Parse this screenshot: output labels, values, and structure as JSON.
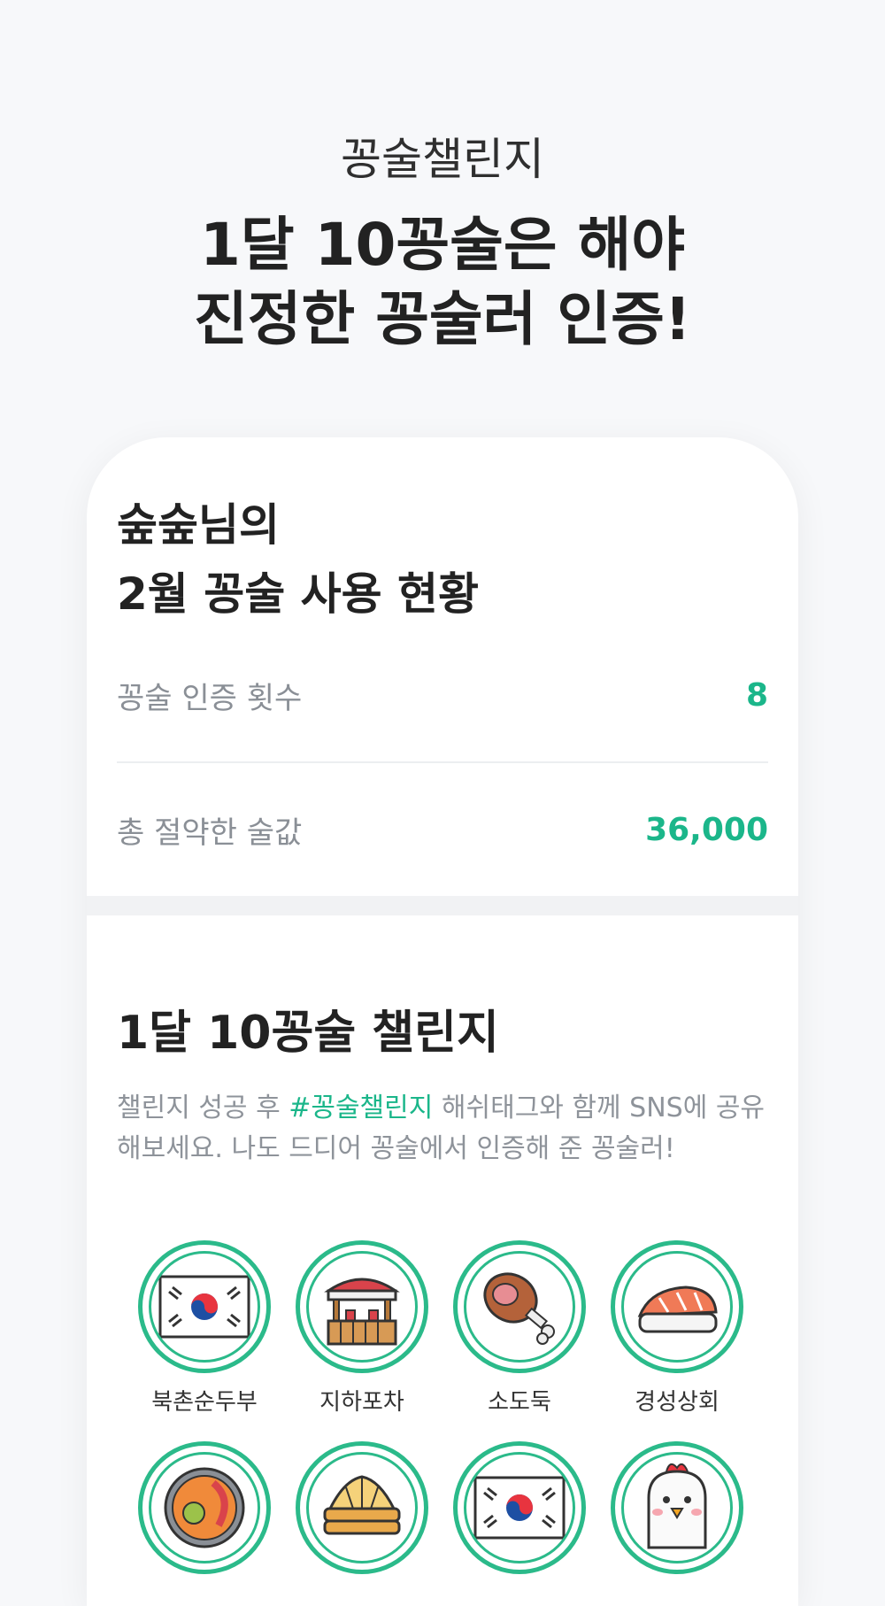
{
  "header": {
    "eyebrow": "꽁술챌린지",
    "headline_line1": "1달 10꽁술은 해야",
    "headline_line2": "진정한 꽁술러 인증!"
  },
  "stats": {
    "title_line1": "숲숲님의",
    "title_line2": "2월 꽁술 사용 현황",
    "rows": [
      {
        "label": "꽁술 인증 횟수",
        "value": "8"
      },
      {
        "label": "총 절약한 술값",
        "value": "36,000"
      }
    ]
  },
  "challenge": {
    "title": "1달 10꽁술 챌린지",
    "desc_before": "챌린지 성공 후 ",
    "desc_tag": "#꽁술챌린지",
    "desc_after": " 해쉬태그와 함께 SNS에 공유해보세요. 나도 드디어 꽁술에서 인증해 준 꽁술러!",
    "stamps": [
      {
        "name": "북촌순두부",
        "icon": "korean-flag-icon"
      },
      {
        "name": "지하포차",
        "icon": "food-stall-icon"
      },
      {
        "name": "소도둑",
        "icon": "meat-leg-icon"
      },
      {
        "name": "경성상회",
        "icon": "salmon-sushi-icon"
      },
      {
        "name": "",
        "icon": "seafood-stew-icon"
      },
      {
        "name": "",
        "icon": "dumpling-steamer-icon"
      },
      {
        "name": "",
        "icon": "korean-flag-icon"
      },
      {
        "name": "",
        "icon": "chicken-icon"
      }
    ]
  },
  "colors": {
    "accent": "#1bb68a",
    "stamp_ring": "#2bba8a",
    "background": "#f7f8fa"
  }
}
